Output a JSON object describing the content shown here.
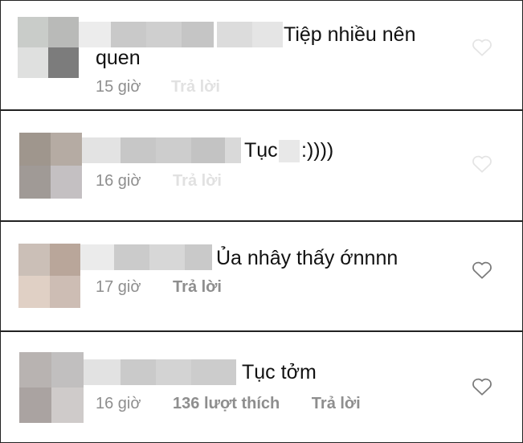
{
  "comments": [
    {
      "text_line1": "Tiệp nhiều nên",
      "text_line2": "quen",
      "time": "15 giờ",
      "likes": "",
      "reply": "Trả lời",
      "reply_faded": true,
      "heart_faded": true
    },
    {
      "text_line1": "Tục",
      "text_line2": ":))))",
      "time": "16 giờ",
      "likes": "",
      "reply": "Trả lời",
      "reply_faded": true,
      "heart_faded": true
    },
    {
      "text_line1": "Ủa nhây thấy ớnnnn",
      "text_line2": "",
      "time": "17 giờ",
      "likes": "",
      "reply": "Trả lời",
      "reply_faded": false,
      "heart_faded": false
    },
    {
      "text_line1": "Tục tởm",
      "text_line2": "",
      "time": "16 giờ",
      "likes": "136 lượt thích",
      "reply": "Trả lời",
      "reply_faded": false,
      "heart_faded": false
    }
  ],
  "colors": {
    "text": "#111111",
    "meta": "#8e8e8e",
    "divider": "#222222",
    "heart": "#7a7a7a"
  }
}
